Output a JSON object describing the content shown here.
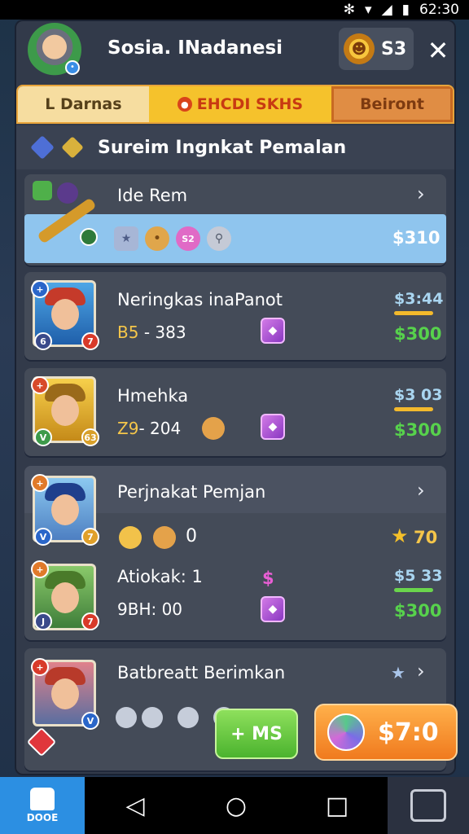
{
  "status_bar": {
    "time": "62:30"
  },
  "header": {
    "title": "Sosia. INadanesi",
    "coins": "S3",
    "close": "✕"
  },
  "tabs": [
    {
      "label": "L Darnas"
    },
    {
      "label": "EHCDI SKHS"
    },
    {
      "label": "Beiront"
    }
  ],
  "section": {
    "title": "Sureim Ingnkat Pemalan"
  },
  "rows": [
    {
      "title": "Ide Rem",
      "price": "$310",
      "icons": [
        "★",
        "•",
        "S2",
        "⚲"
      ]
    },
    {
      "title": "Neringkas inaPanot",
      "stat_a": "B5",
      "stat_b": "- 383",
      "price_top": "$3:44",
      "price": "$300",
      "badges": [
        "6",
        "7"
      ]
    },
    {
      "title": "Hmehka",
      "stat_a": "Z9",
      "stat_b": "- 204",
      "price_top": "$3 03",
      "price": "$300",
      "badges": [
        "V",
        "63"
      ]
    },
    {
      "title": "Perjnakat Pemjan",
      "count": "0",
      "star_value": "70",
      "badges": [
        "V",
        "7"
      ]
    },
    {
      "title": "Atiokak: 1",
      "stat": "9BH: 00",
      "dollar": "$",
      "price_top": "$5 33",
      "price": "$300",
      "badges": [
        "J",
        "7"
      ]
    },
    {
      "title": "Batbreatt Berimkan",
      "badges": [
        "V"
      ]
    }
  ],
  "buttons": {
    "green": "+ MS",
    "orange": "$7:0"
  },
  "navbar": {
    "home_label": "DOOE"
  },
  "colors": {
    "accent_green": "#57d24c",
    "accent_orange": "#f07a1e",
    "tab_gold": "#f5c22c",
    "highlight": "#8fc5ee"
  }
}
